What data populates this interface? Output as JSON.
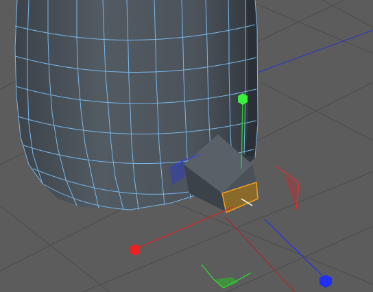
{
  "viewport": {
    "background_color": "#5c5c5c",
    "grid_color": "#4e4e4e",
    "grid_bold_color": "#3f3f3f"
  },
  "mesh": {
    "wire_color": "#7ab8ea",
    "body_color": "#4c535b",
    "shade_color": "#3a4047",
    "extrusion_color": "#5a6168"
  },
  "selection": {
    "color": "#f0a020",
    "fill": "#8a6a2a",
    "mode": "polygon"
  },
  "axes": {
    "x_color": "#e02020",
    "y_color": "#20d020",
    "z_color": "#2030e8",
    "x_handle_icon": "red-hexagon-handle",
    "y_handle_icon": "green-hexagon-handle",
    "z_handle_icon": "blue-hexagon-handle",
    "xy_plane_icon": "xy-plane-handle",
    "xz_plane_icon": "xz-plane-handle",
    "yz_plane_icon": "yz-plane-handle"
  }
}
